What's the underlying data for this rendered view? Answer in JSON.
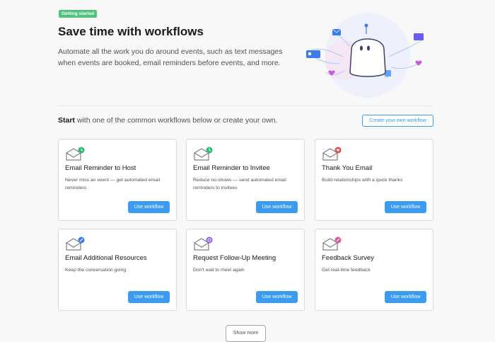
{
  "header": {
    "badge": "Getting started",
    "title": "Save time with workflows",
    "description": "Automate all the work you do around events, such as text messages when events are booked, email reminders before events, and more."
  },
  "start": {
    "bold": "Start",
    "rest": " with one of the common workflows below or create your own.",
    "create_label": "Create your own workflow"
  },
  "cards": [
    {
      "title": "Email Reminder to Host",
      "subtitle": "Never miss an event — get automated email reminders",
      "button": "Use workflow",
      "icon": "clock-icon",
      "color": "#2ebc73"
    },
    {
      "title": "Email Reminder to Invitee",
      "subtitle": "Reduce no-shows — send automated email reminders to invitees",
      "button": "Use workflow",
      "icon": "clock-icon",
      "color": "#2ebc73"
    },
    {
      "title": "Thank You Email",
      "subtitle": "Build relationships with a quick thanks",
      "button": "Use workflow",
      "icon": "heart-icon",
      "color": "#e5484d"
    },
    {
      "title": "Email Additional Resources",
      "subtitle": "Keep the conversation going",
      "button": "Use workflow",
      "icon": "link-icon",
      "color": "#3a7bf0"
    },
    {
      "title": "Request Follow-Up Meeting",
      "subtitle": "Don't wait to meet again",
      "button": "Use workflow",
      "icon": "refresh-icon",
      "color": "#8b5cf6"
    },
    {
      "title": "Feedback Survey",
      "subtitle": "Get real-time feedback",
      "button": "Use workflow",
      "icon": "pencil-icon",
      "color": "#e0569b"
    }
  ],
  "show_more": "Show more"
}
